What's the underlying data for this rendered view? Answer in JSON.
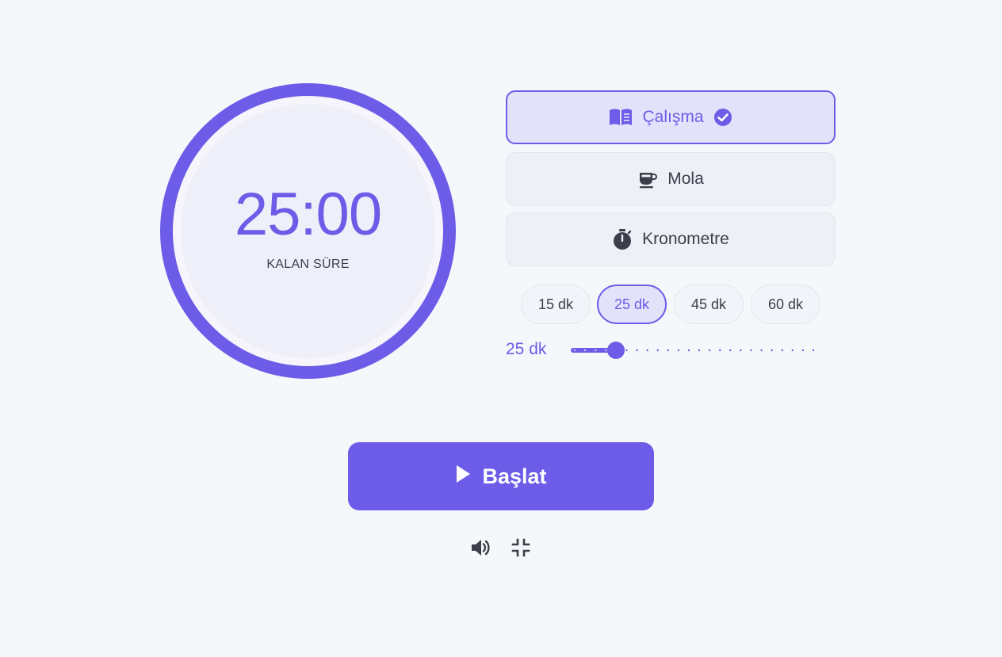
{
  "timer": {
    "time": "25:00",
    "label": "KALAN SÜRE",
    "progress": 1.0
  },
  "modes": [
    {
      "label": "Çalışma",
      "icon": "book-open-icon",
      "active": true,
      "badge_icon": "check-circle-icon"
    },
    {
      "label": "Mola",
      "icon": "coffee-cup-icon",
      "active": false
    },
    {
      "label": "Kronometre",
      "icon": "stopwatch-icon",
      "active": false
    }
  ],
  "presets": [
    {
      "label": "15 dk",
      "active": false
    },
    {
      "label": "25 dk",
      "active": true
    },
    {
      "label": "45 dk",
      "active": false
    },
    {
      "label": "60 dk",
      "active": false
    }
  ],
  "slider": {
    "value_label": "25 dk",
    "value": 25,
    "min": 5,
    "max": 120,
    "step": 5
  },
  "start_button": {
    "label": "Başlat",
    "icon": "play-icon"
  },
  "tools": {
    "sound_icon": "volume-up-icon",
    "compress_icon": "fullscreen-exit-icon"
  },
  "colors": {
    "accent": "#6c5ce7",
    "accent_light": "#e4e2fa",
    "background": "#f6f7fb",
    "text": "#3b3f4a"
  }
}
